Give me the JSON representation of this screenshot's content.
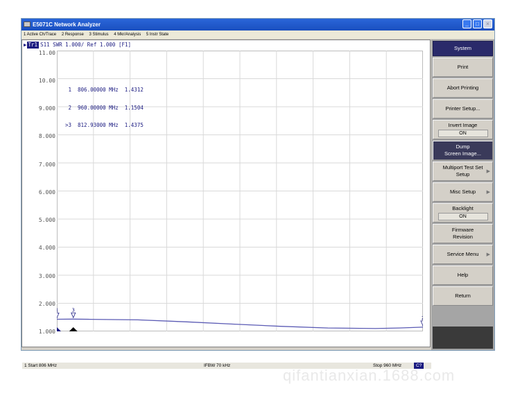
{
  "window": {
    "title": "E5071C Network Analyzer",
    "controls": [
      "_",
      "□",
      "×"
    ]
  },
  "menu": [
    "1 Active Ch/Trace",
    "2 Response",
    "3 Stimulus",
    "4 Mkr/Analysis",
    "5 Instr State"
  ],
  "trace_header": {
    "badge": "Tr1",
    "text": "S11  SWR 1.000/ Ref 1.000 [F1]"
  },
  "y_axis_labels": [
    "11.00",
    "10.00",
    "9.000",
    "8.000",
    "7.000",
    "6.000",
    "5.000",
    "4.000",
    "3.000",
    "2.000",
    "1.000"
  ],
  "markers": [
    {
      "id": "1",
      "freq": "806.00000 MHz",
      "value": "1.4312"
    },
    {
      "id": "2",
      "freq": "960.00000 MHz",
      "value": "1.1504"
    },
    {
      "id": ">3",
      "freq": "812.93000 MHz",
      "value": "1.4375"
    }
  ],
  "marker_flags": [
    "1",
    "2",
    "3"
  ],
  "status": {
    "start": "1  Start 806 MHz",
    "ifbw": "IFBW 70 kHz",
    "stop": "Stop 960 MHz",
    "badge": "C?"
  },
  "softkeys": {
    "header": "System",
    "items": [
      {
        "label": "Print"
      },
      {
        "label": "Abort Printing"
      },
      {
        "label": "Printer Setup..."
      },
      {
        "label": "Invert Image",
        "toggle": "ON"
      },
      {
        "label": "Dump\nScreen Image...",
        "active": true
      },
      {
        "label": "Multiport Test Set\nSetup",
        "submenu": true
      },
      {
        "label": "Misc Setup",
        "submenu": true
      },
      {
        "label": "Backlight",
        "toggle": "ON"
      },
      {
        "label": "Firmware\nRevision"
      },
      {
        "label": "Service Menu",
        "submenu": true
      },
      {
        "label": "Help"
      },
      {
        "label": "Return"
      }
    ]
  },
  "colors": {
    "trace": "#5a5ab4",
    "grid": "#d9d9d9",
    "title_bar": "#2a66d9",
    "marker_color": "#1a1a80"
  },
  "watermark": "qifantianxian.1688.com",
  "chart_data": {
    "type": "line",
    "xlim": [
      806,
      960
    ],
    "ylim": [
      1.0,
      11.0
    ],
    "x_unit": "MHz",
    "grid": true,
    "series": [
      {
        "x": [
          806,
          812.93,
          820,
          840,
          860,
          880,
          900,
          920,
          940,
          950,
          960
        ],
        "values": [
          1.431,
          1.4375,
          1.43,
          1.41,
          1.34,
          1.26,
          1.18,
          1.12,
          1.1,
          1.12,
          1.15
        ]
      }
    ],
    "markers": [
      {
        "id": "1",
        "x": 806,
        "y": 1.4312
      },
      {
        "id": "2",
        "x": 960,
        "y": 1.1504
      },
      {
        "id": "3",
        "x": 812.93,
        "y": 1.4375
      }
    ]
  }
}
